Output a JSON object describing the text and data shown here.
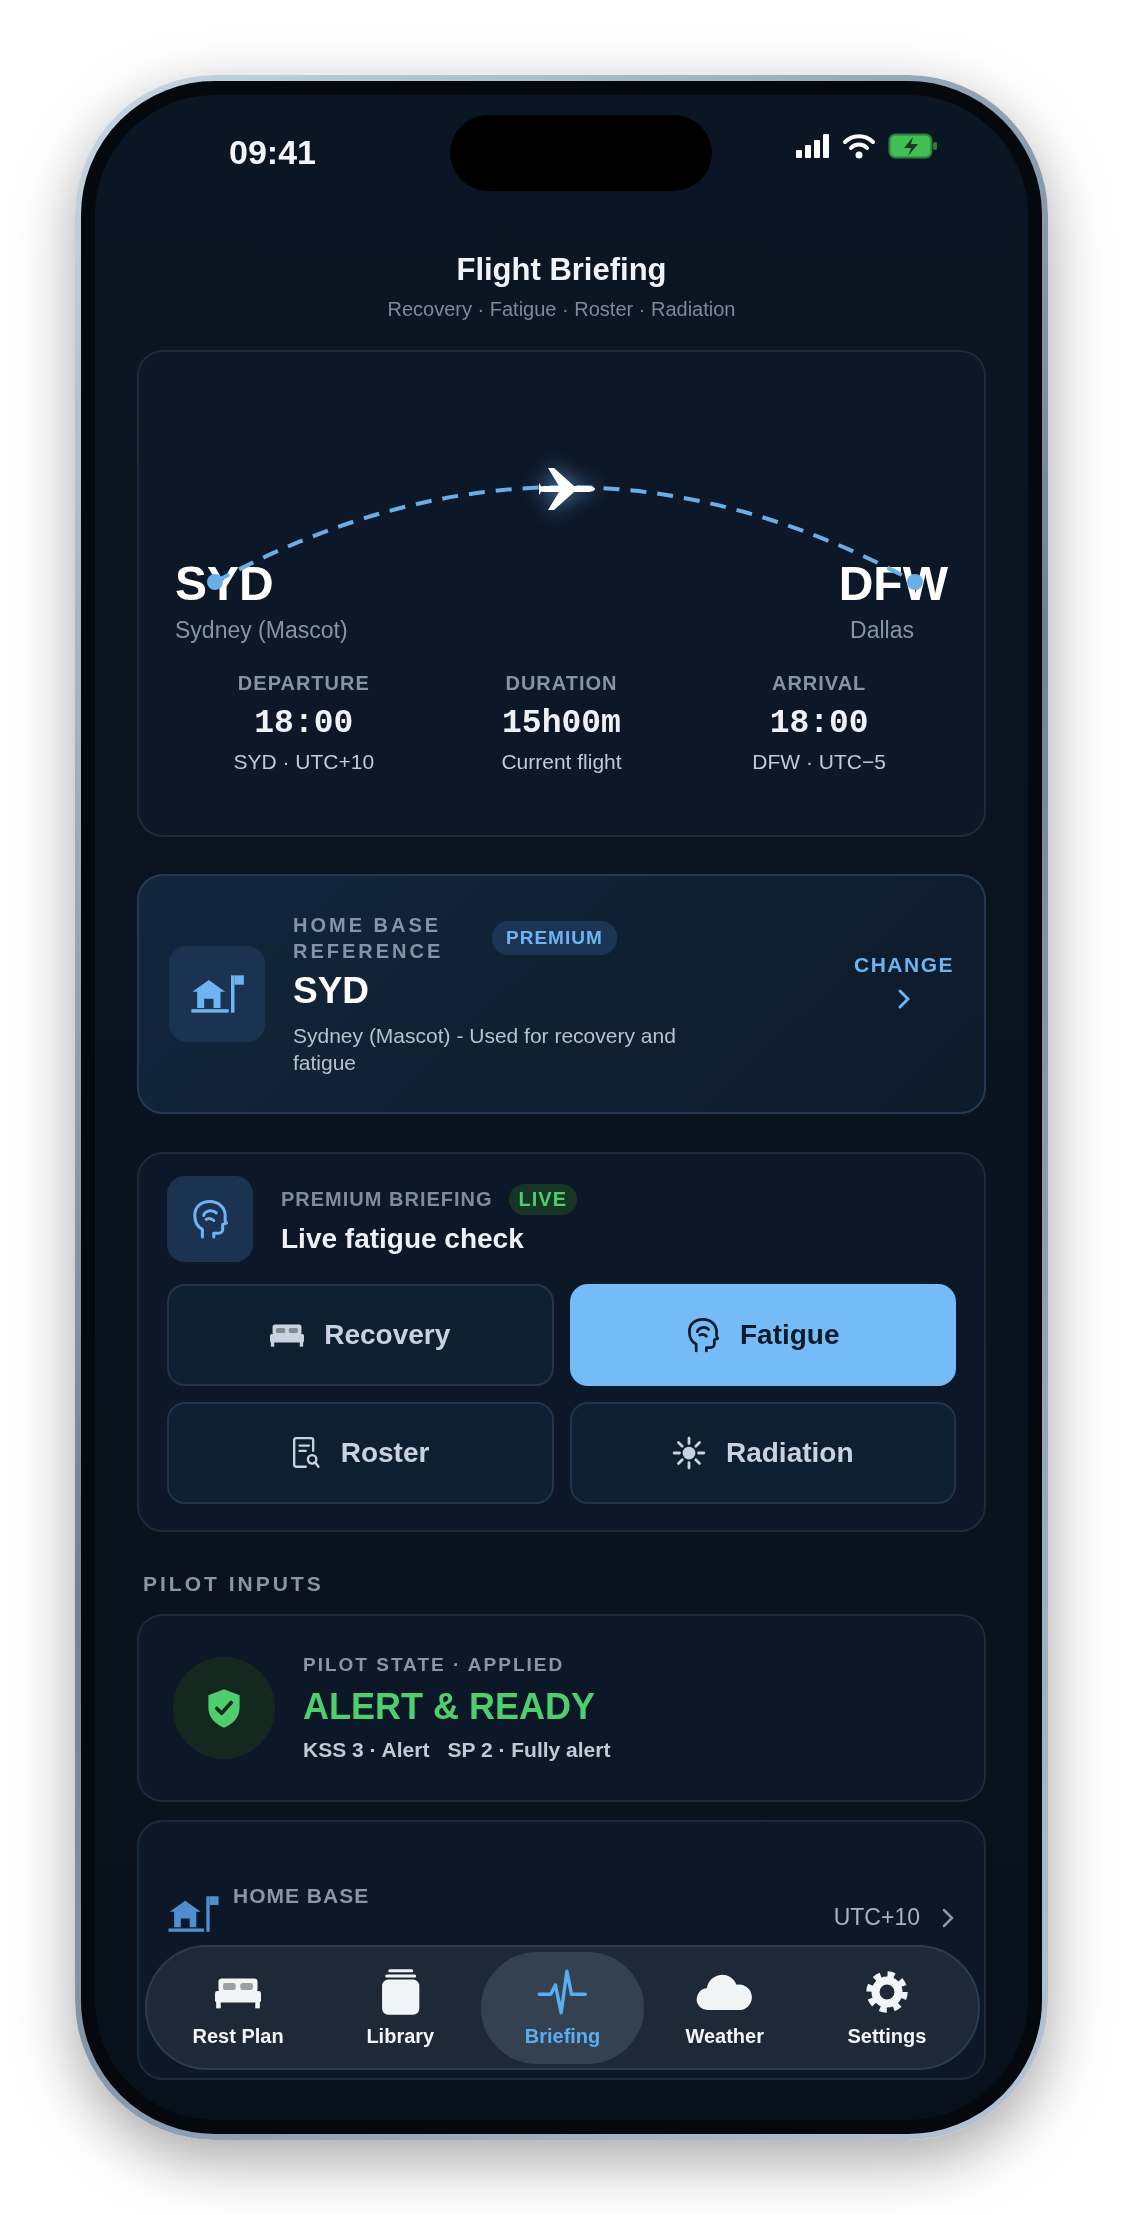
{
  "status_bar": {
    "time": "09:41"
  },
  "header": {
    "title": "Flight Briefing",
    "subtitle": "Recovery · Fatigue · Roster · Radiation"
  },
  "flight": {
    "origin": {
      "code": "SYD",
      "city": "Sydney (Mascot)"
    },
    "destination": {
      "code": "DFW",
      "city": "Dallas"
    },
    "stats": [
      {
        "label": "DEPARTURE",
        "value": "18:00",
        "detail": "SYD · UTC+10"
      },
      {
        "label": "DURATION",
        "value": "15h00m",
        "detail": "Current flight"
      },
      {
        "label": "ARRIVAL",
        "value": "18:00",
        "detail": "DFW · UTC−5"
      }
    ]
  },
  "home_base": {
    "label": "HOME BASE REFERENCE",
    "badge": "PREMIUM",
    "code": "SYD",
    "description": "Sydney (Mascot) - Used for recovery and fatigue",
    "action": "CHANGE"
  },
  "briefing": {
    "label": "PREMIUM BRIEFING",
    "badge": "LIVE",
    "title": "Live fatigue check",
    "modes": [
      {
        "label": "Recovery",
        "kind": "bed",
        "selected": false
      },
      {
        "label": "Fatigue",
        "kind": "head",
        "selected": true
      },
      {
        "label": "Roster",
        "kind": "roster",
        "selected": false
      },
      {
        "label": "Radiation",
        "kind": "sun",
        "selected": false
      }
    ]
  },
  "pilot_inputs": {
    "heading": "PILOT INPUTS",
    "state": {
      "label": "PILOT STATE · APPLIED",
      "value": "ALERT & READY",
      "details": [
        "KSS 3 · Alert",
        "SP 2 · Fully alert"
      ]
    }
  },
  "home_base_row": {
    "label": "HOME BASE",
    "timezone": "UTC+10"
  },
  "tab_bar": [
    {
      "label": "Rest Plan",
      "kind": "bed",
      "selected": false
    },
    {
      "label": "Library",
      "kind": "library",
      "selected": false
    },
    {
      "label": "Briefing",
      "kind": "pulse",
      "selected": true
    },
    {
      "label": "Weather",
      "kind": "cloud",
      "selected": false
    },
    {
      "label": "Settings",
      "kind": "gear",
      "selected": false
    }
  ]
}
